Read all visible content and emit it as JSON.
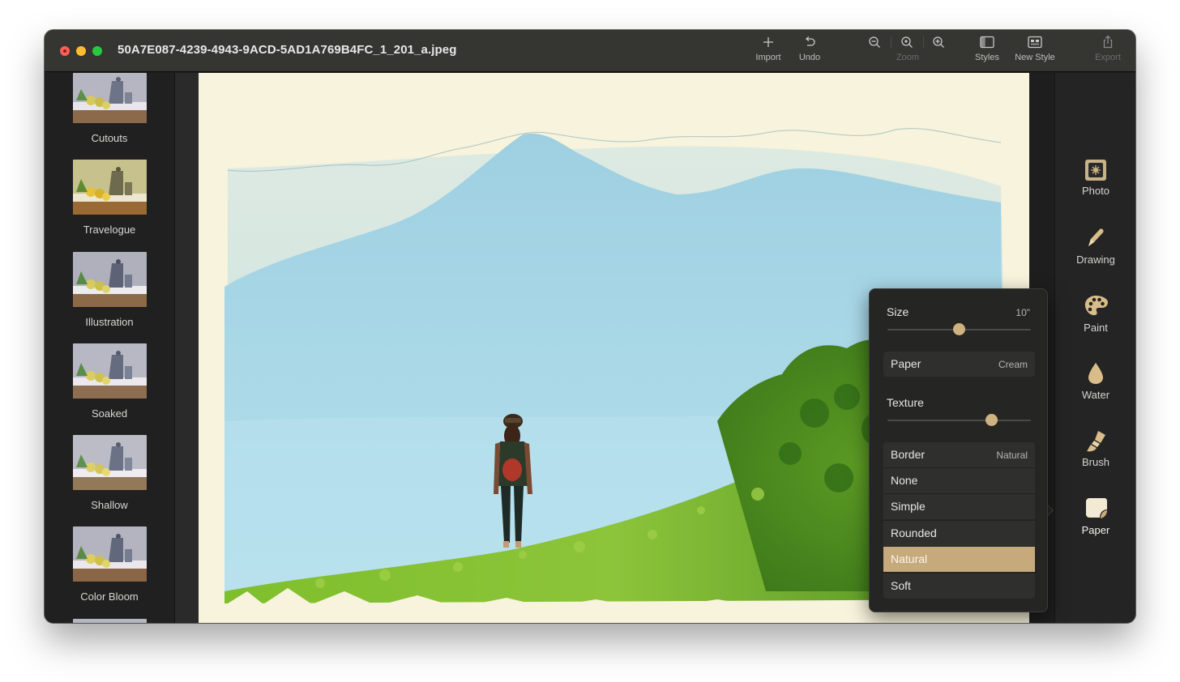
{
  "window": {
    "title": "50A7E087-4239-4943-9ACD-5AD1A769B4FC_1_201_a.jpeg"
  },
  "toolbar": {
    "import_label": "Import",
    "undo_label": "Undo",
    "zoom_label": "Zoom",
    "styles_label": "Styles",
    "new_style_label": "New Style",
    "export_label": "Export"
  },
  "styles_list": {
    "items": [
      {
        "label": "Cutouts"
      },
      {
        "label": "Travelogue"
      },
      {
        "label": "Illustration"
      },
      {
        "label": "Soaked"
      },
      {
        "label": "Shallow"
      },
      {
        "label": "Color Bloom"
      }
    ]
  },
  "tools": {
    "photo_label": "Photo",
    "drawing_label": "Drawing",
    "paint_label": "Paint",
    "water_label": "Water",
    "brush_label": "Brush",
    "paper_label": "Paper",
    "active": "Paper"
  },
  "paper_settings": {
    "size_label": "Size",
    "size_value": "10\"",
    "size_slider": 0.5,
    "paper_label": "Paper",
    "paper_value": "Cream",
    "texture_label": "Texture",
    "texture_slider": 0.73,
    "border_label": "Border",
    "border_value": "Natural",
    "border_options": [
      "None",
      "Simple",
      "Rounded",
      "Natural",
      "Soft"
    ],
    "selected_border": "Natural"
  },
  "colors": {
    "accent": "#c6aa7c",
    "slider_knob": "#d0b281",
    "paper_cream": "#f7f3dc"
  }
}
